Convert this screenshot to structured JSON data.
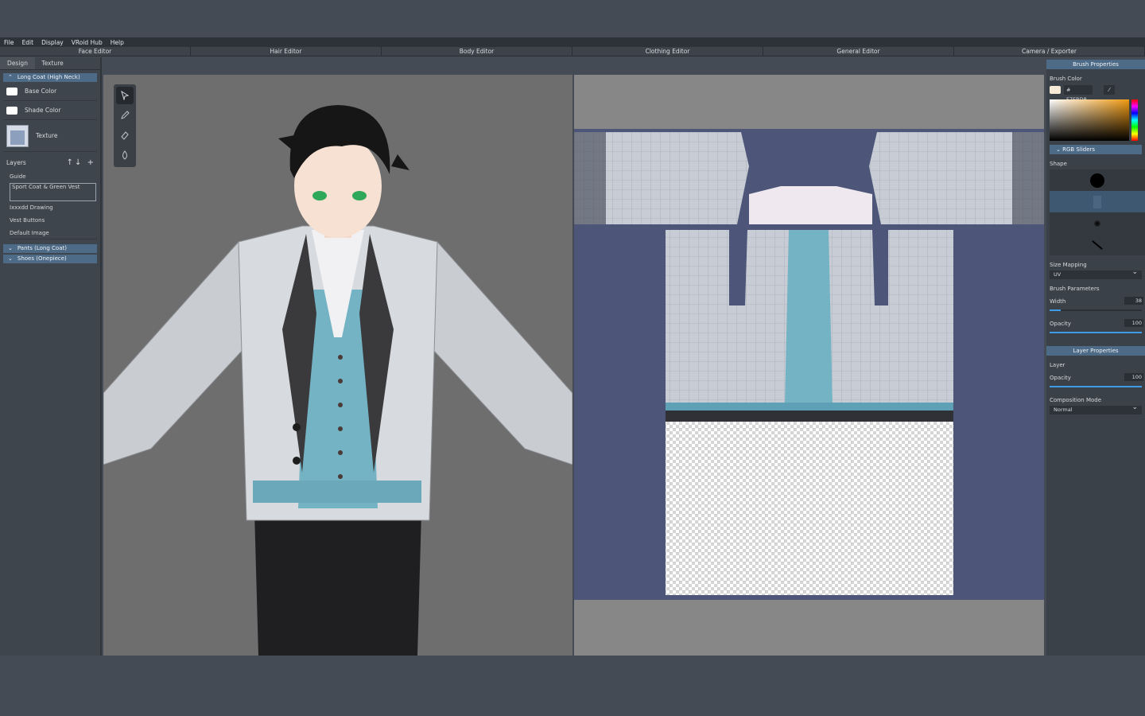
{
  "menu": [
    "File",
    "Edit",
    "Display",
    "VRoid Hub",
    "Help"
  ],
  "editors": [
    "Face Editor",
    "Hair Editor",
    "Body Editor",
    "Clothing Editor",
    "General Editor",
    "Camera / Exporter"
  ],
  "left": {
    "tabs": [
      "Design",
      "Texture"
    ],
    "section_main": "Long Coat (High Neck)",
    "base_color": "Base Color",
    "shade_color": "Shade Color",
    "texture": "Texture",
    "layers_label": "Layers",
    "layers": [
      "Guide",
      "Sport Coat & Green Vest",
      "Ixxxdd Drawing",
      "Vest Buttons",
      "Default Image"
    ],
    "section_pants": "Pants (Long Coat)",
    "section_shoes": "Shoes (Onepiece)"
  },
  "right": {
    "brush_properties": "Brush Properties",
    "brush_color": "Brush Color",
    "hex": "# F7EBD8",
    "rgb_sliders": "RGB Sliders",
    "shape": "Shape",
    "size_mapping": "Size Mapping",
    "size_mapping_value": "UV",
    "brush_parameters": "Brush Parameters",
    "width": "Width",
    "width_value": "38",
    "opacity": "Opacity",
    "opacity_value": "100",
    "layer_properties": "Layer Properties",
    "layer": "Layer",
    "layer_opacity": "Opacity",
    "layer_opacity_value": "100",
    "composition_mode": "Composition Mode",
    "composition_mode_value": "Normal"
  },
  "colors": {
    "accent": "#4d6a86",
    "brush": "#f7ebd8",
    "slider": "#3f9be6"
  }
}
